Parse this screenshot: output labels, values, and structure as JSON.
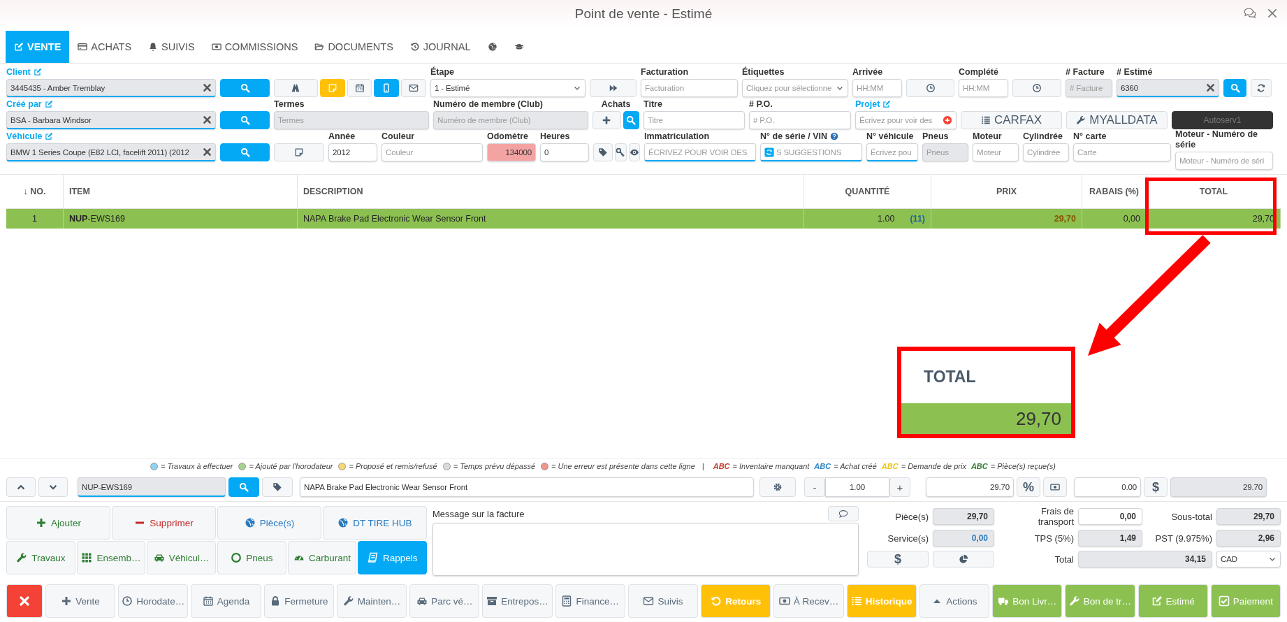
{
  "window": {
    "title": "Point de vente - Estimé"
  },
  "tabs": [
    {
      "label": "VENTE",
      "kind": "edit",
      "selected": true
    },
    {
      "label": "ACHATS",
      "kind": "card",
      "selected": false
    },
    {
      "label": "SUIVIS",
      "kind": "bell",
      "selected": false
    },
    {
      "label": "COMMISSIONS",
      "kind": "money",
      "selected": false
    },
    {
      "label": "DOCUMENTS",
      "kind": "folder",
      "selected": false
    },
    {
      "label": "JOURNAL",
      "kind": "history",
      "selected": false
    },
    {
      "kind": "globe",
      "selected": false
    },
    {
      "kind": "cap",
      "selected": false
    }
  ],
  "form": {
    "line_1": [
      {
        "kind": "field",
        "label": "Client",
        "link": true,
        "value": "3445435 - Amber Tremblay",
        "readonly": true,
        "underline": true,
        "clearable": true
      },
      {
        "kind": "search"
      },
      {
        "kind": "group",
        "buttons": [
          {
            "kind": "road"
          },
          {
            "kind": "note",
            "active": true
          },
          {
            "kind": "calendar"
          },
          {
            "kind": "mobile",
            "active": true
          },
          {
            "kind": "mail"
          }
        ]
      },
      {
        "kind": "select",
        "label": "Étape",
        "value": "1 - Estimé"
      },
      {
        "kind": "forward"
      },
      {
        "kind": "field",
        "label": "Facturation",
        "placeholder": "Facturation"
      },
      {
        "kind": "select",
        "label": "Étiquettes",
        "placeholder": "Cliquez pour sélectionne"
      },
      {
        "kind": "field",
        "label": "Arrivée",
        "placeholder": "HH:MM"
      },
      {
        "kind": "clock"
      },
      {
        "kind": "field",
        "label": "Complété",
        "placeholder": "HH:MM"
      },
      {
        "kind": "clock"
      },
      {
        "kind": "field",
        "label": "# Facture",
        "placeholder": "# Facture",
        "readonly": true
      },
      {
        "kind": "field",
        "label": "# Estimé",
        "value": "6360",
        "readonly": true,
        "underline": true,
        "clearable": true
      },
      {
        "kind": "search"
      },
      {
        "kind": "refresh"
      }
    ],
    "line_2": [
      {
        "kind": "field",
        "label": "Créé par",
        "link": true,
        "value": "BSA - Barbara Windsor",
        "readonly": true,
        "underline": true,
        "clearable": true
      },
      {
        "kind": "search"
      },
      {
        "kind": "field",
        "label": "Termes",
        "placeholder": "Termes",
        "readonly": true
      },
      {
        "kind": "field",
        "label": "Numéro de membre (Club)",
        "placeholder": "Numéro de membre (Club)",
        "readonly": true
      },
      {
        "kind": "group",
        "label": "Achats",
        "buttons": [
          {
            "kind": "plus"
          },
          {
            "kind": "search"
          }
        ]
      },
      {
        "kind": "field",
        "label": "Titre",
        "placeholder": "Titre"
      },
      {
        "kind": "field",
        "label": "# P.O.",
        "placeholder": "# P.O."
      },
      {
        "kind": "field",
        "label": "Projet",
        "link": true,
        "placeholder": "Écrivez pour voir des"
      },
      {
        "kind": "listbutton",
        "text": "CARFAX"
      },
      {
        "kind": "wrenchbutton",
        "text": "MYALLDATA"
      },
      {
        "kind": "darkbutton",
        "text": "Autoserv1"
      }
    ],
    "line_3": [
      {
        "kind": "field",
        "label": "Véhicule",
        "link": true,
        "value": "BMW 1 Series Coupe (E82 LCI, facelift 2011) (2012",
        "readonly": true,
        "underline": true,
        "clearable": true
      },
      {
        "kind": "search"
      },
      {
        "kind": "note",
        "active": false
      },
      {
        "kind": "field",
        "label": "Année",
        "value": "2012"
      },
      {
        "kind": "field",
        "label": "Couleur",
        "placeholder": "Couleur"
      },
      {
        "kind": "field",
        "label": "Odomètre",
        "value": "134000",
        "alert": true
      },
      {
        "kind": "field",
        "label": "Heures",
        "value": "0"
      },
      {
        "kind": "group",
        "buttons": [
          {
            "kind": "tag"
          },
          {
            "kind": "key"
          },
          {
            "kind": "eye"
          }
        ]
      },
      {
        "kind": "field",
        "label": "Immatriculation",
        "placeholder": "ÉCRIVEZ POUR VOIR DES",
        "underline": true
      },
      {
        "kind": "field",
        "label": "N° de série / VIN",
        "help": true,
        "placeholder": "S SUGGESTIONS",
        "underline": true
      },
      {
        "kind": "field",
        "label": "N° véhicule",
        "placeholder": "Écrivez pou",
        "underline": true
      },
      {
        "kind": "field",
        "label": "Pneus",
        "placeholder": "Pneus",
        "readonly": true
      },
      {
        "kind": "field",
        "label": "Moteur",
        "placeholder": "Moteur"
      },
      {
        "kind": "field",
        "label": "Cylindrée",
        "placeholder": "Cylindrée"
      },
      {
        "kind": "field",
        "label": "N° carte",
        "placeholder": "Carte"
      },
      {
        "kind": "field",
        "label": "Moteur - Numéro de série",
        "placeholder": "Moteur - Numéro de séri"
      }
    ]
  },
  "table": {
    "columns": [
      "↓ NO.",
      "ITEM",
      "DESCRIPTION",
      "QUANTITÉ",
      "PRIX",
      "RABAIS (%)",
      "TOTAL"
    ],
    "rows": [
      {
        "no": "1",
        "item": "**NUP**-EWS169",
        "description": "NAPA Brake Pad Electronic Wear Sensor Front",
        "quantity": "1.00",
        "stock": "(11)",
        "price": "29,70",
        "discount": "0,00",
        "total": "29,70",
        "color": "#8cc152"
      }
    ]
  },
  "callout": {
    "heading": "TOTAL",
    "value": "29,70"
  },
  "legend": {
    "dots": [
      {
        "color": "#8fd3f4",
        "text": "= Travaux à effectuer"
      },
      {
        "color": "#a9d18e",
        "text": "= Ajouté par l'horodateur"
      },
      {
        "color": "#f7d774",
        "text": "= Proposé et remis/refusé"
      },
      {
        "color": "#d9dadc",
        "text": "= Temps prévu dépassé"
      },
      {
        "color": "#f1948a",
        "text": "= Une erreur est présente dans cette ligne"
      }
    ],
    "separator": "|",
    "marks": [
      {
        "mark": "ABC",
        "color": "#c0392b",
        "text": "= Inventaire manquant"
      },
      {
        "mark": "ABC",
        "color": "#2e86c1",
        "text": "= Achat créé"
      },
      {
        "mark": "ABC",
        "color": "#f1c40f",
        "text": "= Demande de prix"
      },
      {
        "mark": "ABC",
        "color": "#2e7d32",
        "text": "= Pièce(s) reçue(s)"
      }
    ]
  },
  "edit_line": {
    "item": "NUP-EWS169",
    "description": "NAPA Brake Pad Electronic Wear Sensor Front",
    "minus": "-",
    "quantity": "1.00",
    "plus": "+",
    "price": "29.70",
    "percent": "%",
    "discount": "0.00",
    "dollar": "$",
    "total": "29.70"
  },
  "actions": {
    "row_1": [
      {
        "label": "Ajouter",
        "kind": "plus",
        "selected": false
      },
      {
        "label": "Supprimer",
        "kind": "minus",
        "selected": false
      },
      {
        "label": "Pièce(s)",
        "kind": "globe",
        "selected": false
      },
      {
        "label": "DT TIRE HUB",
        "kind": "globe",
        "selected": false
      }
    ],
    "row_2": [
      {
        "label": "Travaux",
        "kind": "wrench",
        "selected": false
      },
      {
        "label": "Ensemb…",
        "kind": "grid",
        "selected": false
      },
      {
        "label": "Véhicul…",
        "kind": "car",
        "selected": false
      },
      {
        "label": "Pneus",
        "kind": "ring",
        "selected": false
      },
      {
        "label": "Carburant",
        "kind": "gauge",
        "selected": false
      },
      {
        "label": "Rappels",
        "kind": "book",
        "selected": true
      }
    ]
  },
  "message": {
    "label": "Message sur la facture"
  },
  "totals": {
    "pieces": {
      "label": "Pièce(s)",
      "value": "29,70"
    },
    "services": {
      "label": "Service(s)",
      "value": "0,00"
    },
    "dollar": "$",
    "shipping": {
      "label": "Frais de transport",
      "value": "0,00"
    },
    "tps": {
      "label": "TPS (5%)",
      "value": "1,49"
    },
    "total": {
      "label": "Total",
      "value": "34,15"
    },
    "subtotal": {
      "label": "Sous-total",
      "value": "29,70"
    },
    "pst": {
      "label": "PST (9.975%)",
      "value": "2,96"
    },
    "currency": "CAD"
  },
  "toolbar": [
    {
      "kind": "times"
    },
    {
      "label": "Vente",
      "kind": "plus"
    },
    {
      "label": "Horodate…",
      "kind": "clock"
    },
    {
      "label": "Agenda",
      "kind": "calendar"
    },
    {
      "label": "Fermeture",
      "kind": "lock"
    },
    {
      "label": "Mainten…",
      "kind": "wrench"
    },
    {
      "label": "Parc vé…",
      "kind": "car"
    },
    {
      "label": "Entrepos…",
      "kind": "archive"
    },
    {
      "label": "Finance…",
      "kind": "calc"
    },
    {
      "label": "Suivis",
      "kind": "mail"
    },
    {
      "label": "Retours",
      "kind": "undo"
    },
    {
      "label": "À Recev…",
      "kind": "money"
    },
    {
      "label": "Historique",
      "kind": "list"
    },
    {
      "label": "Actions",
      "kind": "caret"
    },
    {
      "label": "Bon Livr…",
      "kind": "truck"
    },
    {
      "label": "Bon de tr…",
      "kind": "wrench"
    },
    {
      "label": "Estimé",
      "kind": "edit"
    },
    {
      "label": "Paiement",
      "kind": "check"
    }
  ]
}
